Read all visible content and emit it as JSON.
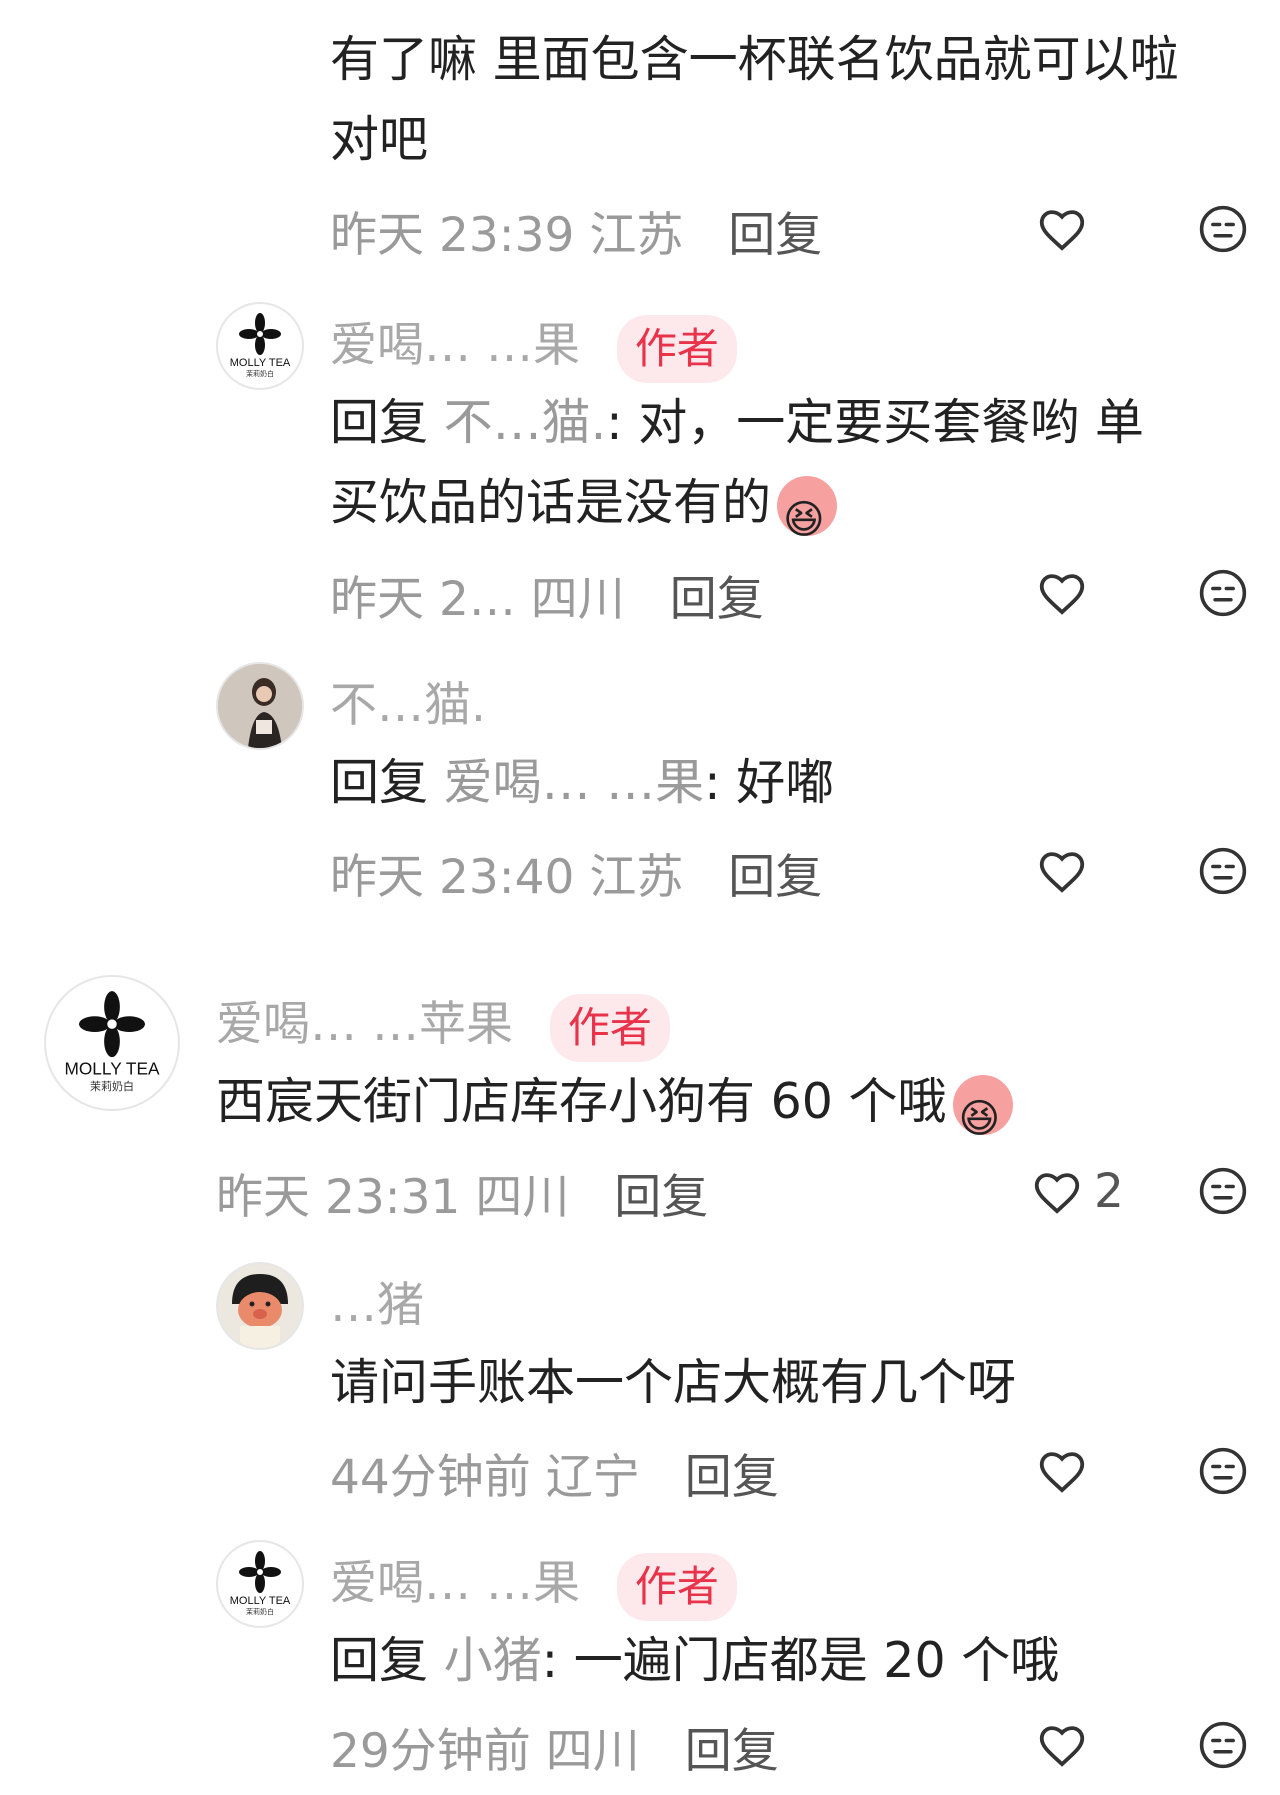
{
  "comments": [
    {
      "id": "c1",
      "text_lines": [
        "有了嘛 里面包含一杯联名饮品就可以啦",
        "对吧"
      ],
      "time": "昨天 23:39",
      "location": "江苏",
      "reply_label": "回复"
    },
    {
      "id": "c2",
      "name": "爱喝… …果",
      "author_badge": "作者",
      "reply_prefix": "回复",
      "reply_target": "不…猫.",
      "text_line1": ": 对，一定要买套餐哟 单",
      "text_line2": "买饮品的话是没有的",
      "time": "昨天 2…",
      "location": "四川",
      "reply_label": "回复"
    },
    {
      "id": "c3",
      "name": "不…猫.",
      "reply_prefix": "回复",
      "reply_target": "爱喝… …果",
      "text": ": 好嘟",
      "time": "昨天 23:40",
      "location": "江苏",
      "reply_label": "回复"
    },
    {
      "id": "c4",
      "name": "爱喝… …苹果",
      "author_badge": "作者",
      "text": "西宸天街门店库存小狗有 60 个哦",
      "time": "昨天 23:31",
      "location": "四川",
      "reply_label": "回复",
      "likes": "2"
    },
    {
      "id": "c5",
      "name": "…猪",
      "text": "请问手账本一个店大概有几个呀",
      "time": "44分钟前",
      "location": "辽宁",
      "reply_label": "回复"
    },
    {
      "id": "c6",
      "name": "爱喝… …果",
      "author_badge": "作者",
      "reply_prefix": "回复",
      "reply_target": "小猪",
      "text": ": 一遍门店都是 20 个哦",
      "time": "29分钟前",
      "location": "四川",
      "reply_label": "回复"
    }
  ],
  "brand": {
    "logo_text": "MOLLY TEA",
    "logo_sub": "茉莉奶白"
  },
  "colors": {
    "author_badge_bg": "#fde9ec",
    "author_badge_text": "#e8334a",
    "meta": "#9a9a9a"
  },
  "icons": {
    "like": "heart-outline-icon",
    "dislike": "neutral-face-icon"
  }
}
